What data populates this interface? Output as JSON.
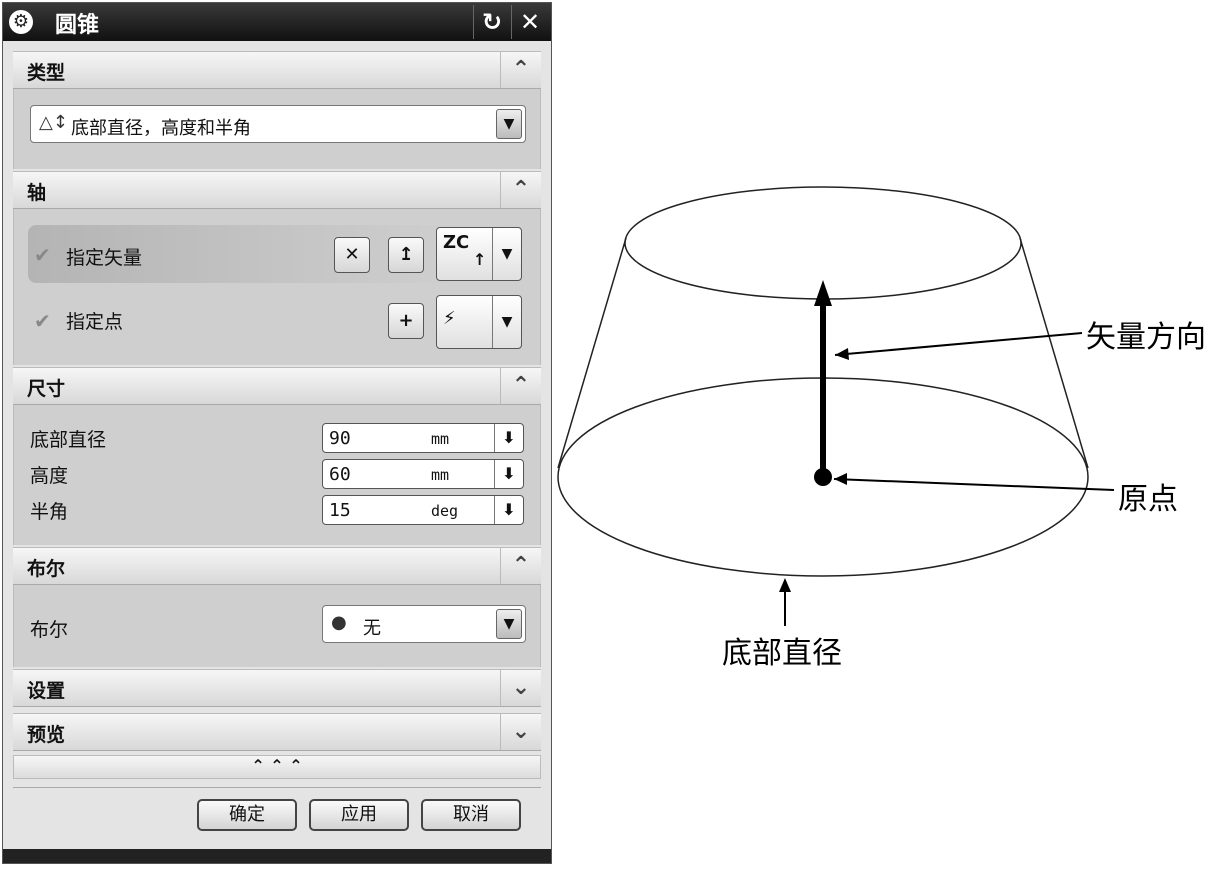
{
  "dialog": {
    "title": "圆锥",
    "title_icon": "gear-icon",
    "reset_icon": "reset-icon",
    "close_icon": "close-icon"
  },
  "sections": {
    "type": {
      "header": "类型",
      "selected": "底部直径，高度和半角"
    },
    "axis": {
      "header": "轴",
      "specify_vector": "指定矢量",
      "specify_point": "指定点",
      "vector_option": "ZC"
    },
    "dimensions": {
      "header": "尺寸",
      "rows": [
        {
          "label": "底部直径",
          "value": "90",
          "unit": "mm"
        },
        {
          "label": "高度",
          "value": "60",
          "unit": "mm"
        },
        {
          "label": "半角",
          "value": "15",
          "unit": "deg"
        }
      ]
    },
    "boolean": {
      "header": "布尔",
      "label": "布尔",
      "selected": "无"
    },
    "settings": {
      "header": "设置"
    },
    "preview": {
      "header": "预览"
    }
  },
  "footer": {
    "ok": "确定",
    "apply": "应用",
    "cancel": "取消"
  },
  "diagram": {
    "labels": {
      "vector_direction": "矢量方向",
      "origin": "原点",
      "bottom_diameter": "底部直径"
    }
  }
}
